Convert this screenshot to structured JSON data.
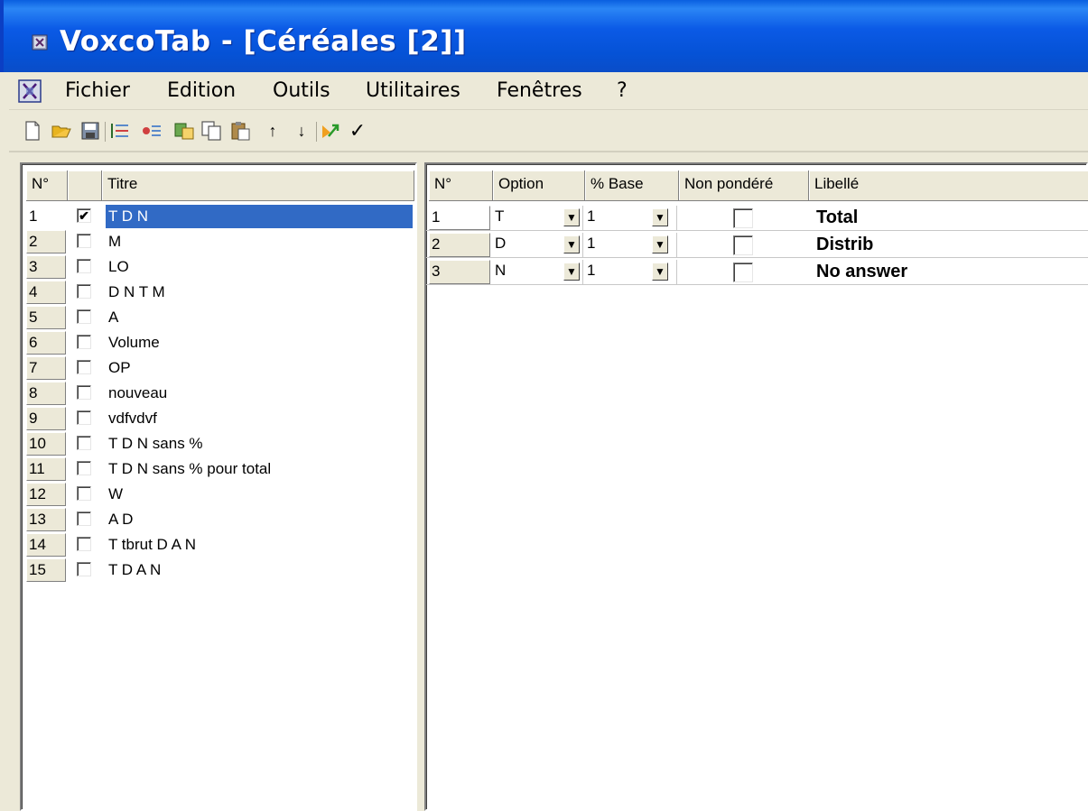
{
  "window": {
    "title": "VoxcoTab - [Céréales [2]]"
  },
  "menubar": {
    "items": [
      "Fichier",
      "Edition",
      "Outils",
      "Utilitaires",
      "Fenêtres",
      "?"
    ]
  },
  "toolbar": {
    "icons": [
      "new-icon",
      "open-icon",
      "save-icon",
      "insert-row-icon",
      "delete-row-icon",
      "duplicate-icon",
      "copy-icon",
      "paste-icon",
      "move-up-icon",
      "move-down-icon",
      "export-icon",
      "validate-icon"
    ],
    "up_glyph": "↑",
    "down_glyph": "↓",
    "check_glyph": "✓"
  },
  "left_table": {
    "headers": {
      "num": "N°",
      "check": "",
      "title": "Titre"
    },
    "rows": [
      {
        "n": "1",
        "checked": true,
        "title": "T D N"
      },
      {
        "n": "2",
        "checked": false,
        "title": "M"
      },
      {
        "n": "3",
        "checked": false,
        "title": "LO"
      },
      {
        "n": "4",
        "checked": false,
        "title": "D N T M"
      },
      {
        "n": "5",
        "checked": false,
        "title": "A"
      },
      {
        "n": "6",
        "checked": false,
        "title": "Volume"
      },
      {
        "n": "7",
        "checked": false,
        "title": "OP"
      },
      {
        "n": "8",
        "checked": false,
        "title": "nouveau"
      },
      {
        "n": "9",
        "checked": false,
        "title": "vdfvdvf"
      },
      {
        "n": "10",
        "checked": false,
        "title": "T D N sans %"
      },
      {
        "n": "11",
        "checked": false,
        "title": "T D N sans % pour total"
      },
      {
        "n": "12",
        "checked": false,
        "title": "W"
      },
      {
        "n": "13",
        "checked": false,
        "title": "A D"
      },
      {
        "n": "14",
        "checked": false,
        "title": "T  tbrut  D A N"
      },
      {
        "n": "15",
        "checked": false,
        "title": "T D A N"
      }
    ],
    "check_glyph": "✔"
  },
  "right_table": {
    "headers": {
      "num": "N°",
      "option": "Option",
      "base": "% Base",
      "weighted": "Non pondéré",
      "label": "Libellé"
    },
    "rows": [
      {
        "n": "1",
        "option": "T",
        "base": "1",
        "unweighted": false,
        "label": "Total"
      },
      {
        "n": "2",
        "option": "D",
        "base": "1",
        "unweighted": false,
        "label": "Distrib"
      },
      {
        "n": "3",
        "option": "N",
        "base": "1",
        "unweighted": false,
        "label": "No answer"
      }
    ],
    "dropdown_glyph": "▼"
  }
}
